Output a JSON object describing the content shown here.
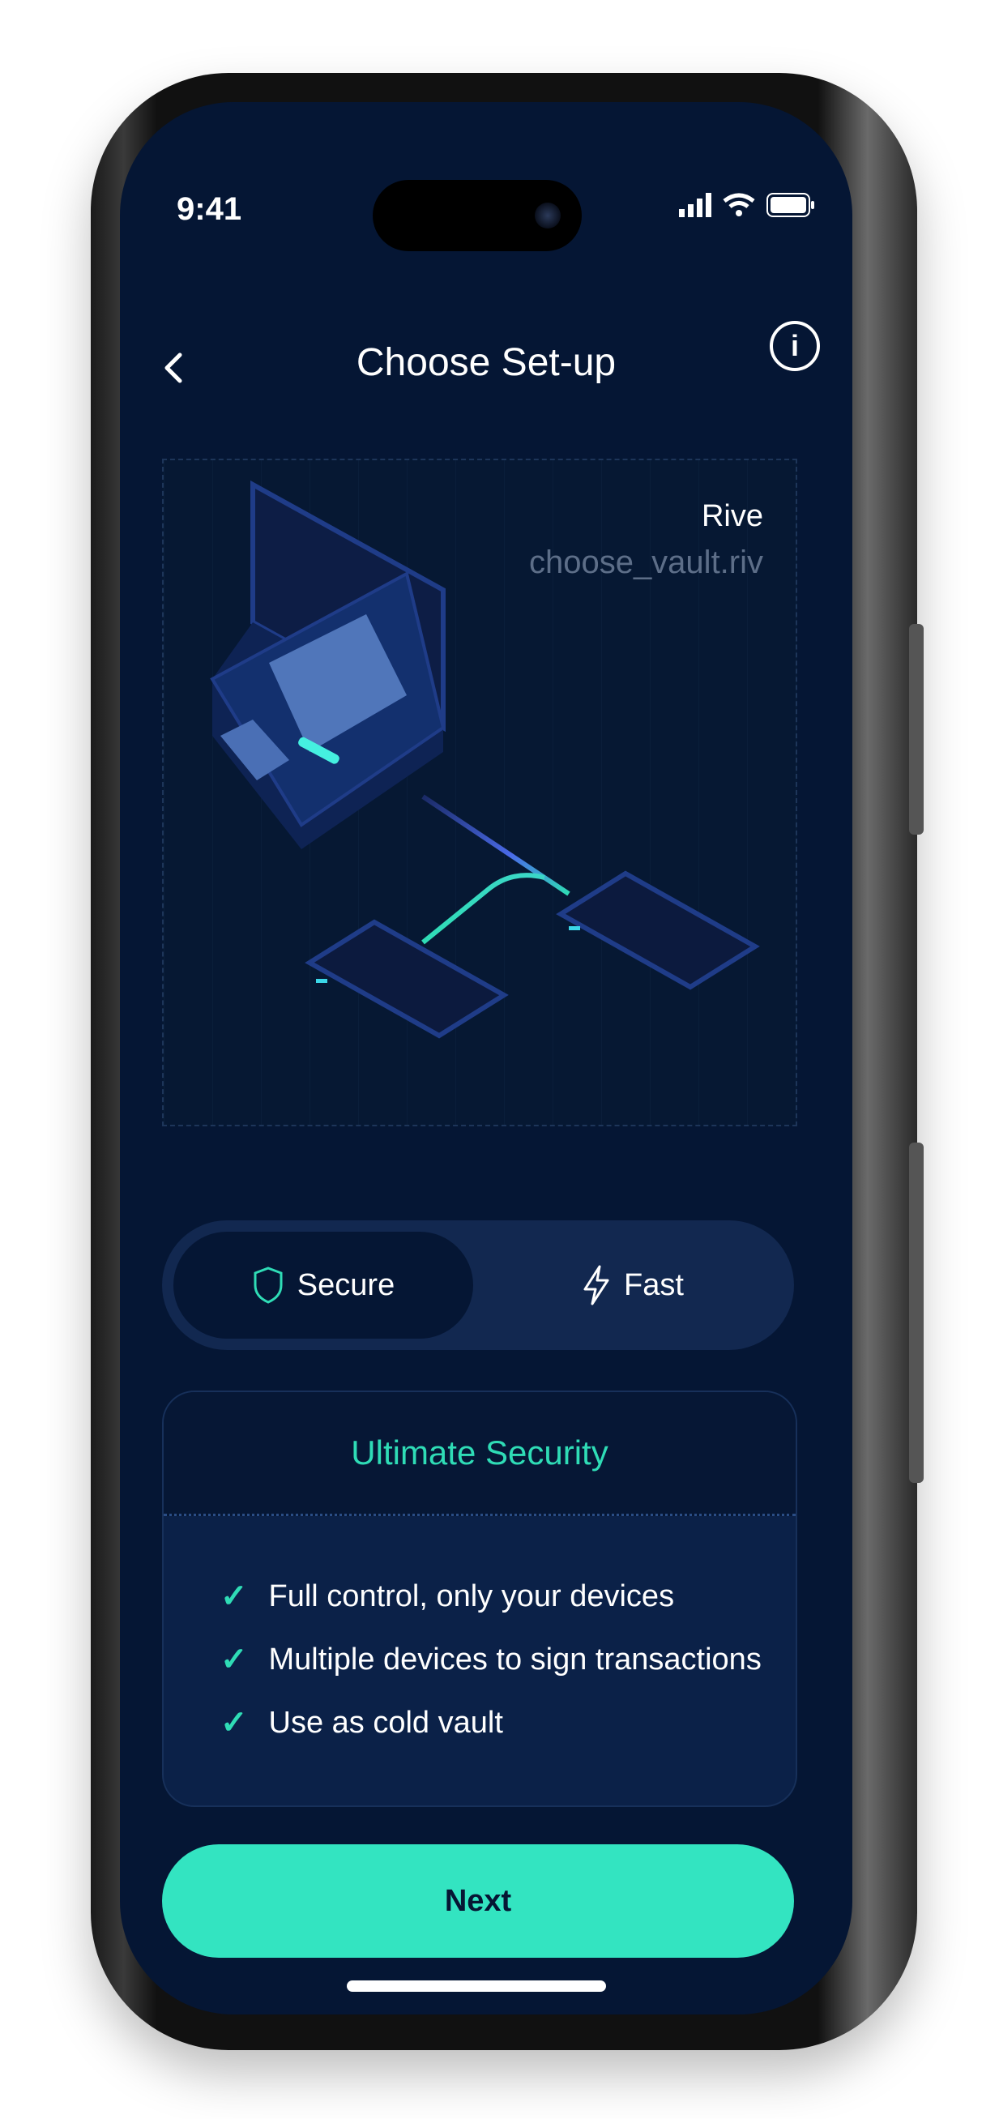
{
  "status_bar": {
    "time": "9:41"
  },
  "header": {
    "title": "Choose Set-up",
    "back_icon": "chevron-left-icon",
    "info_label": "i"
  },
  "illustration": {
    "label": "Rive",
    "file_name": "choose_vault.riv"
  },
  "mode_toggle": {
    "options": [
      {
        "label": "Secure",
        "icon": "shield-icon",
        "selected": true
      },
      {
        "label": "Fast",
        "icon": "lightning-icon",
        "selected": false
      }
    ]
  },
  "security_card": {
    "title": "Ultimate Security",
    "features": [
      "Full control, only your devices",
      "Multiple devices to sign transactions",
      "Use as cold vault"
    ]
  },
  "next_button": {
    "label": "Next"
  },
  "colors": {
    "accent": "#33E4C1",
    "background": "#051634",
    "surface": "#122850"
  }
}
